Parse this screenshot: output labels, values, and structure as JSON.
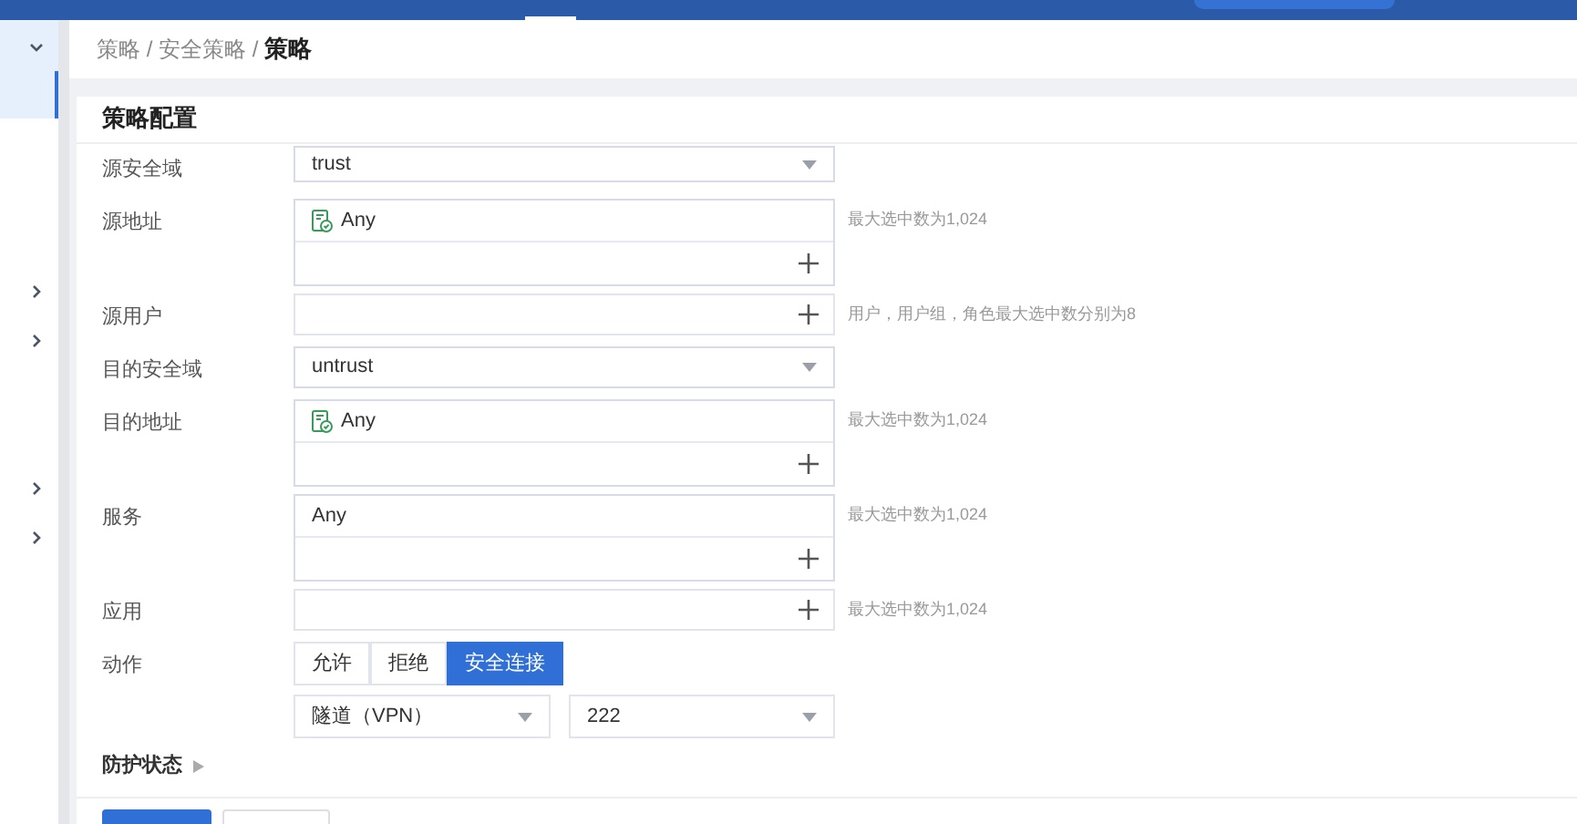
{
  "sidebar": {
    "items": [
      {
        "expanded": true,
        "selected": true
      },
      {
        "expanded": false,
        "selected": false
      },
      {
        "expanded": false,
        "selected": false
      },
      {
        "expanded": false,
        "selected": false
      },
      {
        "expanded": false,
        "selected": false
      }
    ]
  },
  "breadcrumb": "策略 / 安全策略 / **策略**",
  "card": {
    "title": "策略配置",
    "rows": [
      {
        "kind": "select",
        "label": "源安全域",
        "value": "trust"
      },
      {
        "kind": "multi",
        "label": "源地址",
        "items": [
          {
            "text": "Any",
            "icon": true
          }
        ],
        "hint": "最大选中数为1,024"
      },
      {
        "kind": "add",
        "label": "源用户",
        "hint": "用户，用户组，角色最大选中数分别为8"
      },
      {
        "kind": "select",
        "label": "目的安全域",
        "value": "untrust"
      },
      {
        "kind": "multi",
        "label": "目的地址",
        "items": [
          {
            "text": "Any",
            "icon": true
          }
        ],
        "hint": "最大选中数为1,024"
      },
      {
        "kind": "multi",
        "label": "服务",
        "items": [
          {
            "text": "Any",
            "icon": false
          }
        ],
        "hint": "最大选中数为1,024"
      },
      {
        "kind": "add",
        "label": "应用",
        "hint": "最大选中数为1,024"
      },
      {
        "kind": "segmented",
        "label": "动作",
        "options": [
          {
            "label": "允许",
            "selected": false
          },
          {
            "label": "拒绝",
            "selected": false
          },
          {
            "label": "安全连接",
            "selected": true
          }
        ]
      },
      {
        "kind": "pair",
        "selects": [
          "隧道（VPN）",
          "222"
        ]
      }
    ],
    "section": {
      "label": "防护状态",
      "expanded": false
    }
  }
}
